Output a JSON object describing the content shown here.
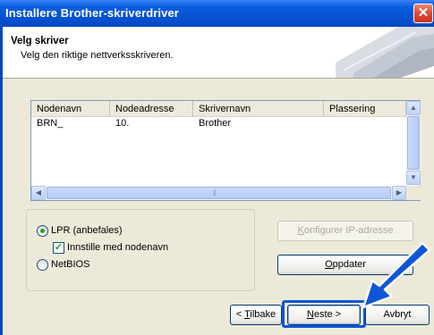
{
  "window": {
    "title": "Installere Brother-skriverdriver",
    "close_glyph": "✕"
  },
  "header": {
    "title": "Velg skriver",
    "subtitle": "Velg den riktige nettverksskriveren."
  },
  "list": {
    "columns": [
      "Nodenavn",
      "Nodeadresse",
      "Skrivernavn",
      "Plassering"
    ],
    "rows": [
      [
        "BRN_",
        "10.",
        "Brother",
        ""
      ]
    ]
  },
  "options": {
    "lpr": {
      "label": "LPR (anbefales)",
      "checked": true
    },
    "set_with_nodename": {
      "label": "Innstille med nodenavn",
      "checked": true
    },
    "netbios": {
      "label": "NetBIOS",
      "checked": false
    }
  },
  "buttons": {
    "configure_ip": {
      "prefix": "",
      "accel": "K",
      "rest": "onfigurer IP-adresse",
      "enabled": false
    },
    "update": {
      "prefix": "",
      "accel": "O",
      "rest": "ppdater"
    },
    "back": {
      "prefix": "< ",
      "accel": "T",
      "rest": "ilbake"
    },
    "next": {
      "prefix": "",
      "accel": "N",
      "rest": "este >"
    },
    "cancel": {
      "label": "Avbryt"
    }
  },
  "icons": {
    "check": "✓",
    "scroll_up": "▲",
    "scroll_down": "▼",
    "scroll_left": "◀",
    "scroll_right": "▶",
    "grip": "|||"
  },
  "colors": {
    "titlebar": "#0553d4",
    "highlight": "#0f56d6",
    "radio_dot": "#21a121"
  }
}
